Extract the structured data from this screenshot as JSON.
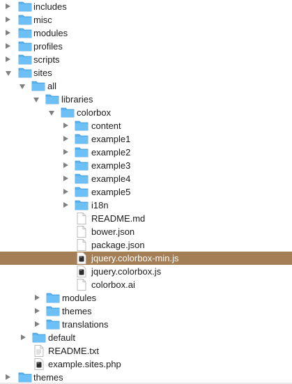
{
  "tree": {
    "includes": "includes",
    "misc": "misc",
    "modules": "modules",
    "profiles": "profiles",
    "scripts": "scripts",
    "sites": "sites",
    "all": "all",
    "libraries": "libraries",
    "colorbox": "colorbox",
    "content": "content",
    "example1": "example1",
    "example2": "example2",
    "example3": "example3",
    "example4": "example4",
    "example5": "example5",
    "i18n": "i18n",
    "readme_md": "README.md",
    "bower_json": "bower.json",
    "package_json": "package.json",
    "jquery_colorbox_min": "jquery.colorbox-min.js",
    "jquery_colorbox": "jquery.colorbox.js",
    "colorbox_ai": "colorbox.ai",
    "all_modules": "modules",
    "all_themes": "themes",
    "translations": "translations",
    "default": "default",
    "readme_txt": "README.txt",
    "example_sites_php": "example.sites.php",
    "themes": "themes"
  },
  "colors": {
    "folder": "#5ab3f0",
    "selection": "#a47e55",
    "disclosure": "#808080"
  }
}
